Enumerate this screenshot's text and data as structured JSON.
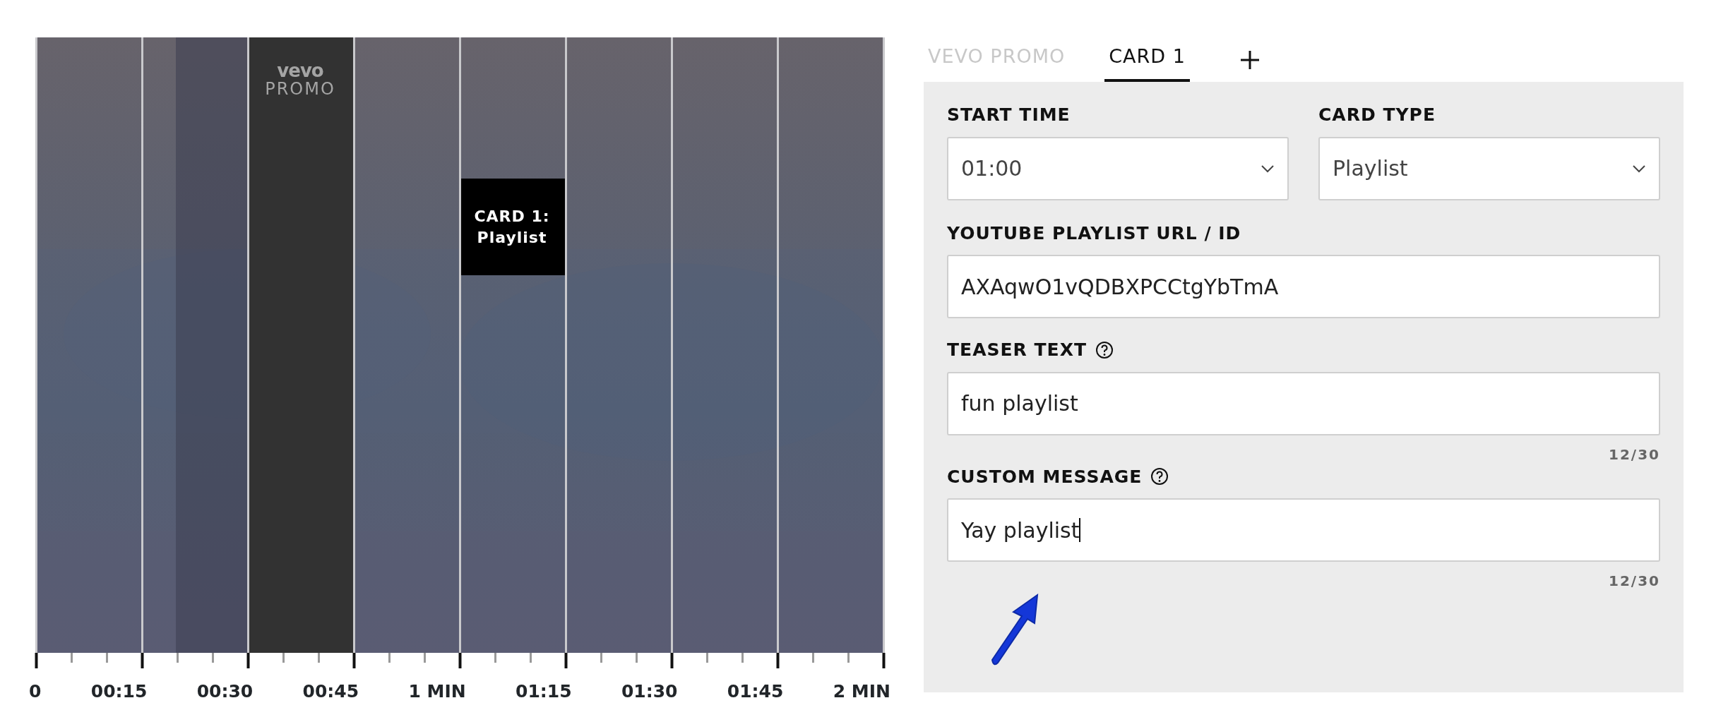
{
  "timeline": {
    "blocks": [
      {
        "kind": "promo",
        "logo": "vevo",
        "label": "PROMO"
      },
      {
        "kind": "card",
        "label": "CARD 1:",
        "sublabel": "Playlist"
      }
    ],
    "axis_labels": [
      "0",
      "00:15",
      "00:30",
      "00:45",
      "1 MIN",
      "01:15",
      "01:30",
      "01:45",
      "2 MIN"
    ]
  },
  "tabs": [
    {
      "label": "VEVO PROMO",
      "selected": false
    },
    {
      "label": "CARD 1",
      "selected": true
    }
  ],
  "form": {
    "selects": [
      {
        "label": "START TIME",
        "value": "01:00"
      },
      {
        "label": "CARD TYPE",
        "value": "Playlist"
      }
    ],
    "fields": [
      {
        "label": "YOUTUBE PLAYLIST URL / ID",
        "help": false,
        "value": "AXAqwO1vQDBXPCCtgYbTmA",
        "focused": false
      },
      {
        "label": "TEASER TEXT",
        "help": true,
        "value": "fun playlist",
        "counter": "12/30",
        "focused": false
      },
      {
        "label": "CUSTOM MESSAGE",
        "help": true,
        "value": "Yay playlist",
        "counter": "12/30",
        "focused": true
      }
    ]
  }
}
